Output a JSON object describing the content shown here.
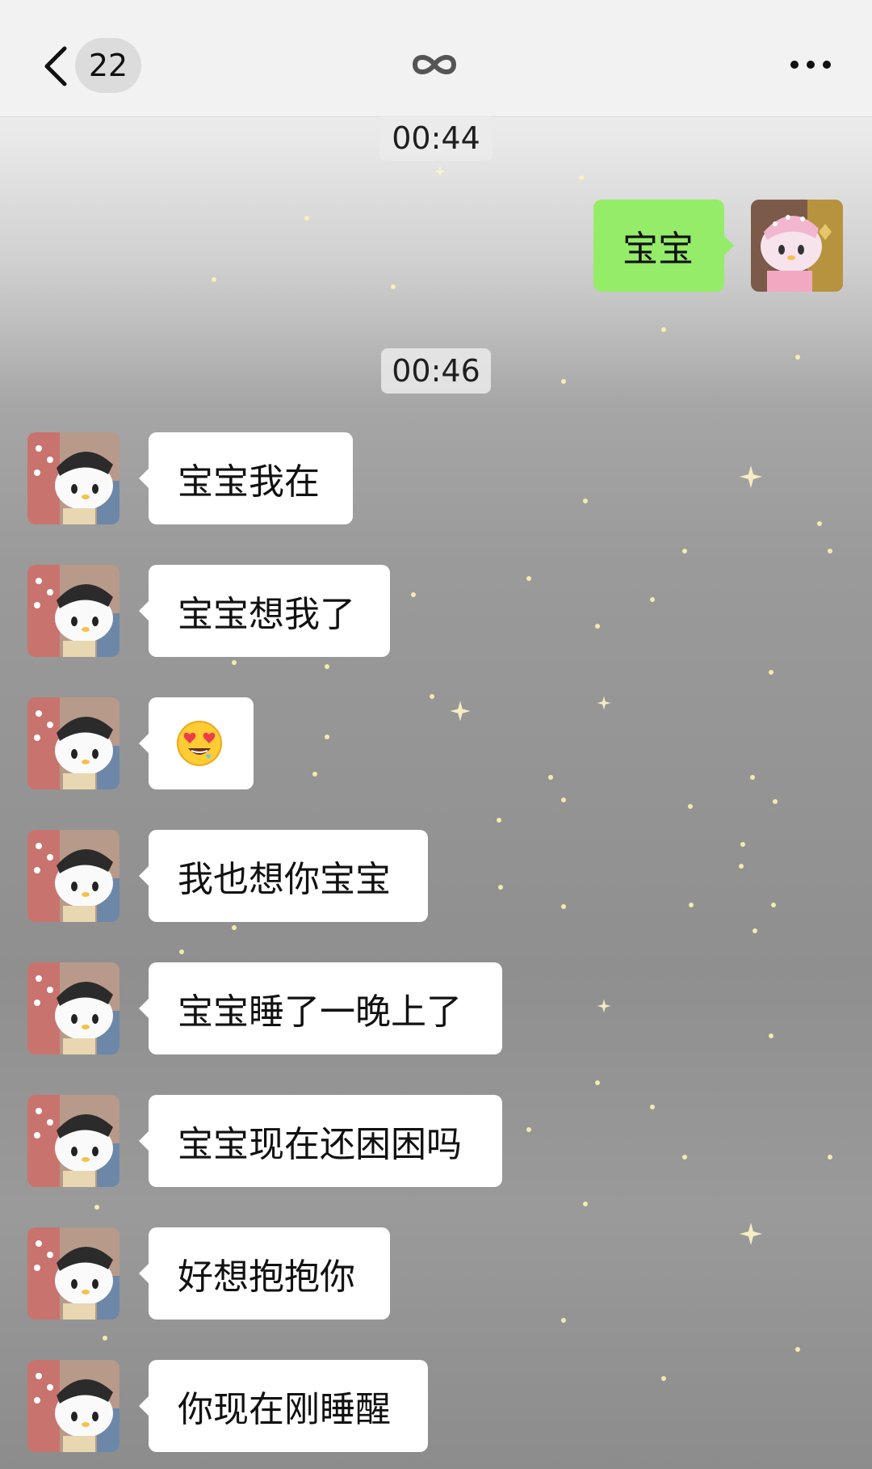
{
  "header": {
    "back_icon": "chevron-left-icon",
    "unread_count": "22",
    "title_icon": "infinity-icon",
    "more_icon": "more-dots-icon"
  },
  "timestamps": [
    "00:44",
    "00:46"
  ],
  "messages": [
    {
      "side": "out",
      "text": "宝宝"
    },
    {
      "side": "in",
      "text": "宝宝我在"
    },
    {
      "side": "in",
      "text": "宝宝想我了"
    },
    {
      "side": "in",
      "emoji": "heart-eyes-emoji"
    },
    {
      "side": "in",
      "text": "我也想你宝宝"
    },
    {
      "side": "in",
      "text": "宝宝睡了一晚上了"
    },
    {
      "side": "in",
      "text": "宝宝现在还困困吗"
    },
    {
      "side": "in",
      "text": "好想抱抱你"
    },
    {
      "side": "in",
      "text": "你现在刚睡醒"
    }
  ],
  "colors": {
    "outgoing_bubble": "#95ec69",
    "incoming_bubble": "#ffffff",
    "header_bg": "#f2f2f2"
  }
}
